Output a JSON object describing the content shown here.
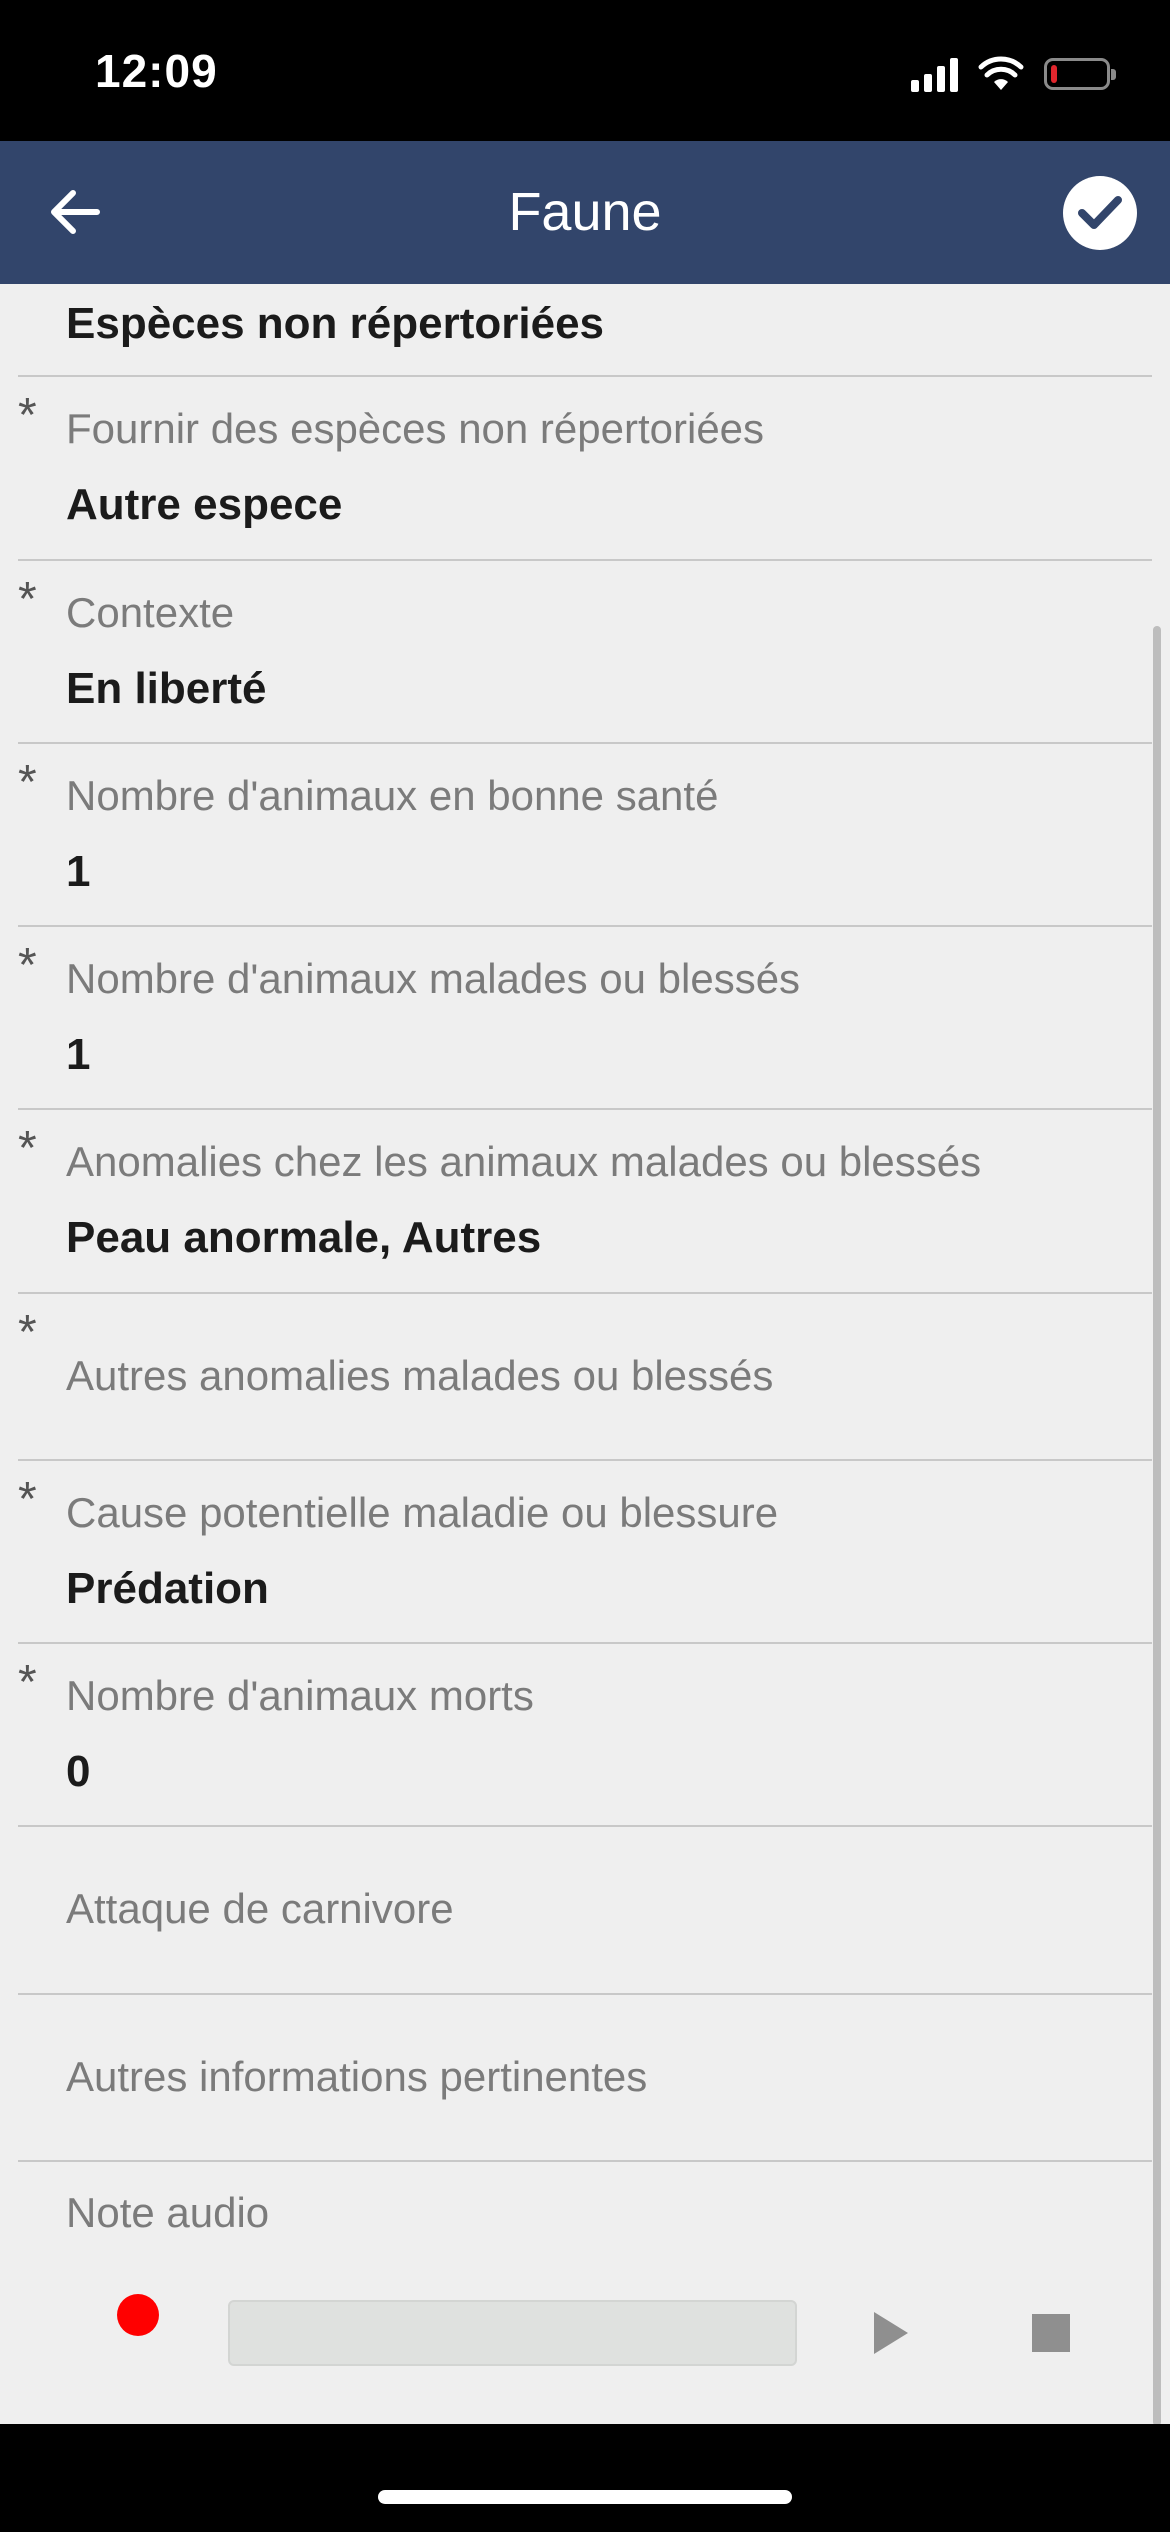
{
  "status_bar": {
    "time": "12:09",
    "battery_level_percent": 10,
    "battery_color": "#e0262d"
  },
  "header": {
    "title": "Faune",
    "back_icon": "arrow-left-icon",
    "confirm_icon": "check-circle-icon",
    "color": "#32456b"
  },
  "fields": [
    {
      "label": "",
      "value": "Espèces non répertoriées",
      "required": false
    },
    {
      "label": "Fournir des espèces non répertoriées",
      "value": "Autre espece",
      "required": true
    },
    {
      "label": "Contexte",
      "value": "En liberté",
      "required": true
    },
    {
      "label": "Nombre d'animaux en bonne santé",
      "value": "1",
      "required": true
    },
    {
      "label": "Nombre d'animaux malades ou blessés",
      "value": "1",
      "required": true
    },
    {
      "label": "Anomalies chez les animaux malades ou blessés",
      "value": "Peau anormale, Autres",
      "required": true
    },
    {
      "label": "Autres anomalies malades ou blessés",
      "value": "",
      "required": true
    },
    {
      "label": "Cause potentielle maladie ou blessure",
      "value": "Prédation",
      "required": true
    },
    {
      "label": "Nombre d'animaux morts",
      "value": "0",
      "required": true
    },
    {
      "label": "Attaque de carnivore",
      "value": "",
      "required": false
    },
    {
      "label": "Autres informations pertinentes",
      "value": "",
      "required": false
    }
  ],
  "audio": {
    "label": "Note audio",
    "record_icon": "record-icon",
    "play_icon": "play-icon",
    "stop_icon": "stop-icon",
    "record_color": "#ff0000"
  },
  "required_marker": "*"
}
